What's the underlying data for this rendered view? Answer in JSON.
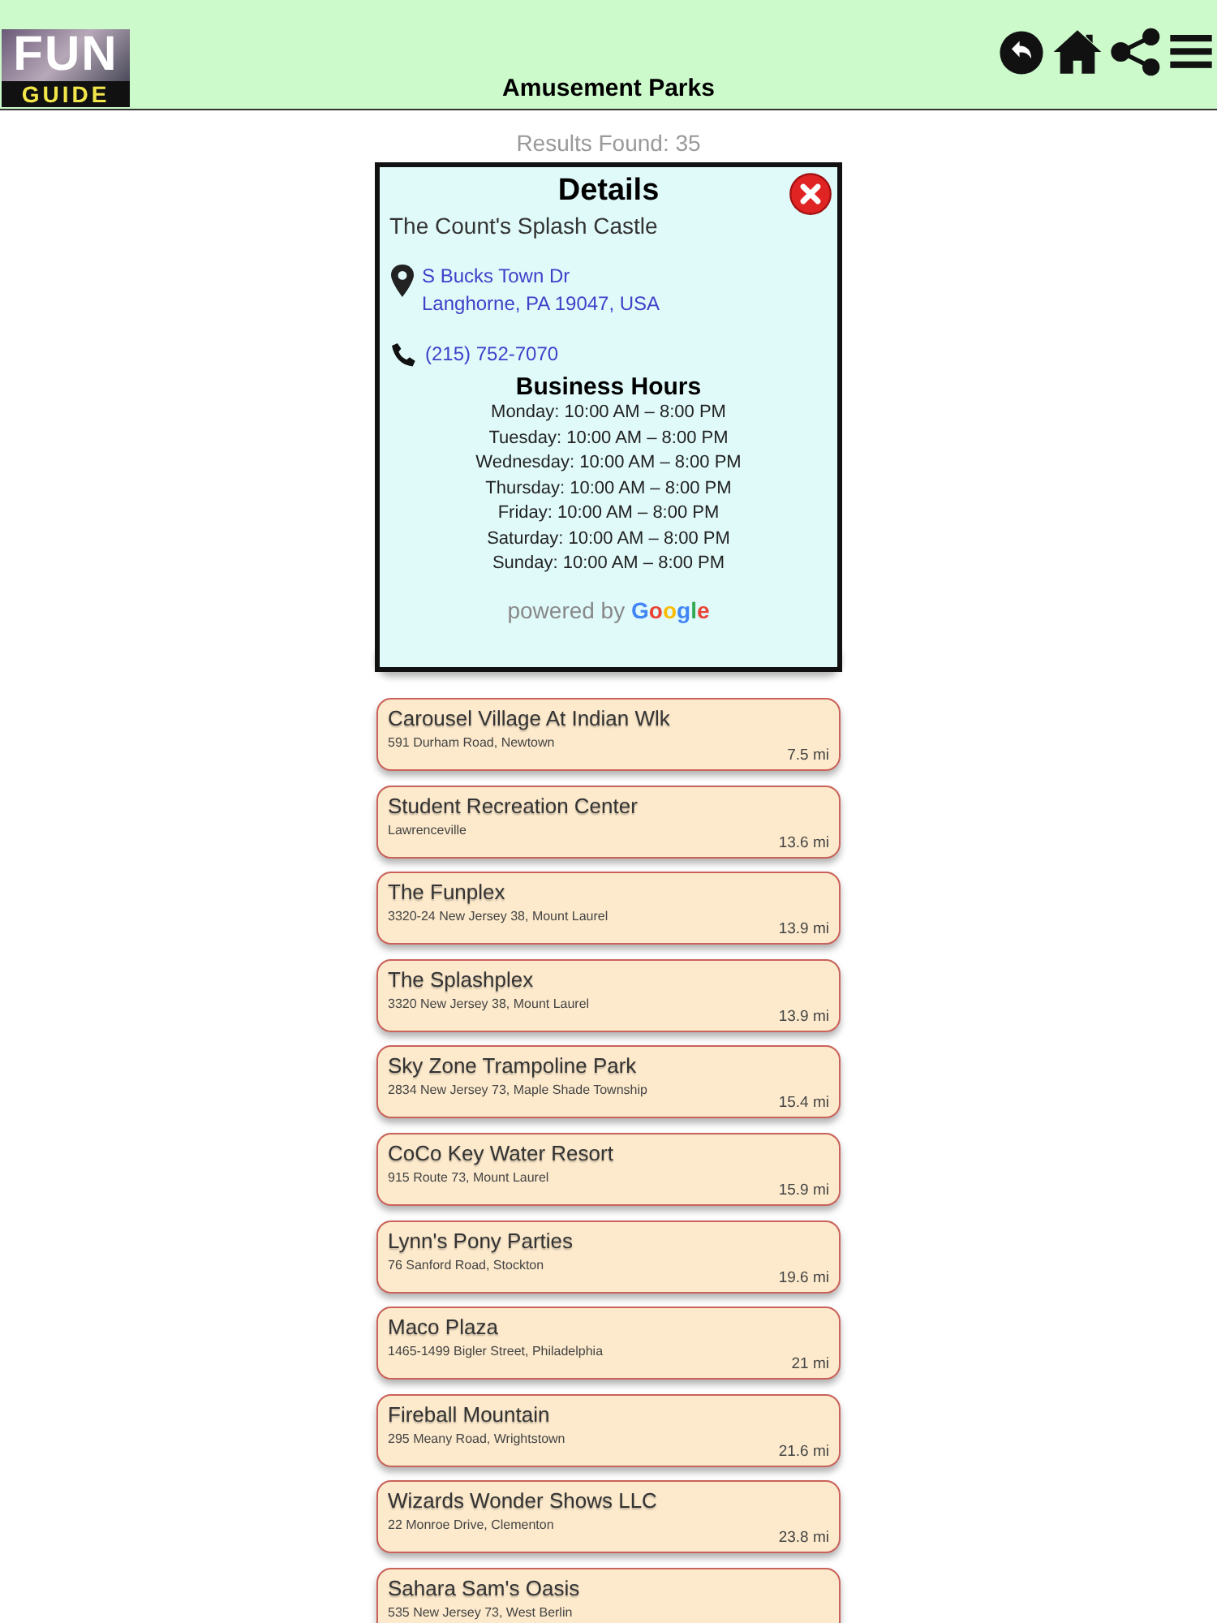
{
  "header": {
    "logo_top": "FUN",
    "logo_bottom": "GUIDE",
    "title": "Amusement Parks"
  },
  "results": "Results Found: 35",
  "details": {
    "title": "Details",
    "name": "The Count's Splash Castle",
    "address_lines": [
      "S Bucks Town Dr",
      "Langhorne, PA 19047, USA"
    ],
    "phone": "(215) 752-7070",
    "hours_title": "Business Hours",
    "hours": [
      "Monday: 10:00 AM – 8:00 PM",
      "Tuesday: 10:00 AM – 8:00 PM",
      "Wednesday: 10:00 AM – 8:00 PM",
      "Thursday: 10:00 AM – 8:00 PM",
      "Friday: 10:00 AM – 8:00 PM",
      "Saturday: 10:00 AM – 8:00 PM",
      "Sunday: 10:00 AM – 8:00 PM"
    ],
    "powered_by": "powered by",
    "brand": "Google"
  },
  "places": [
    {
      "name": "Carousel Village At Indian Wlk",
      "address": "591 Durham Road, Newtown",
      "distance": "7.5 mi"
    },
    {
      "name": "Student Recreation Center",
      "address": "Lawrenceville",
      "distance": "13.6 mi"
    },
    {
      "name": "The Funplex",
      "address": "3320-24 New Jersey 38, Mount Laurel",
      "distance": "13.9 mi"
    },
    {
      "name": "The Splashplex",
      "address": "3320 New Jersey 38, Mount Laurel",
      "distance": "13.9 mi"
    },
    {
      "name": "Sky Zone Trampoline Park",
      "address": "2834 New Jersey 73, Maple Shade Township",
      "distance": "15.4 mi"
    },
    {
      "name": "CoCo Key Water Resort",
      "address": "915 Route 73, Mount Laurel",
      "distance": "15.9 mi"
    },
    {
      "name": "Lynn's Pony Parties",
      "address": "76 Sanford Road, Stockton",
      "distance": "19.6 mi"
    },
    {
      "name": "Maco Plaza",
      "address": "1465-1499 Bigler Street, Philadelphia",
      "distance": "21 mi"
    },
    {
      "name": "Fireball Mountain",
      "address": "295 Meany Road, Wrightstown",
      "distance": "21.6 mi"
    },
    {
      "name": "Wizards Wonder Shows LLC",
      "address": "22 Monroe Drive, Clementon",
      "distance": "23.8 mi"
    },
    {
      "name": "Sahara Sam's Oasis",
      "address": "535 New Jersey 73, West Berlin"
    }
  ]
}
